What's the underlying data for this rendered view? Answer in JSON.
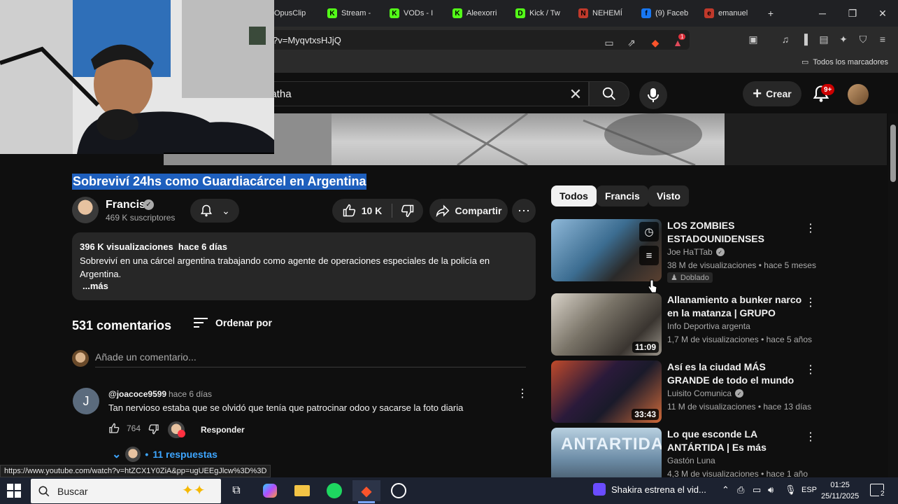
{
  "browser": {
    "tabs": [
      {
        "label": "OpusClip",
        "fav_color": "#4d5bd1",
        "fav_glyph": "O"
      },
      {
        "label": "Stream -",
        "fav_color": "#53fc18",
        "fav_glyph": "K"
      },
      {
        "label": "VODs - I",
        "fav_color": "#53fc18",
        "fav_glyph": "K"
      },
      {
        "label": "Aleexorri",
        "fav_color": "#53fc18",
        "fav_glyph": "K"
      },
      {
        "label": "Kick / Tw",
        "fav_color": "#53fc18",
        "fav_glyph": "D"
      },
      {
        "label": "NEHEMÍ",
        "fav_color": "#c0392b",
        "fav_glyph": "N"
      },
      {
        "label": "(9) Faceb",
        "fav_color": "#1877f2",
        "fav_glyph": "f"
      },
      {
        "label": "emanuel",
        "fav_color": "#c0392b",
        "fav_glyph": "e"
      }
    ],
    "new_tab": "+",
    "url": "?v=MyqvtxsHJjQ",
    "brave_shield_count": "1",
    "bookmarks_label": "Todos los marcadores"
  },
  "youtube": {
    "search_query": "natha",
    "create_label": "Crear",
    "notification_badge": "9+"
  },
  "video": {
    "title": "Sobreviví 24hs como Guardiacárcel en Argentina",
    "channel": "Francis",
    "subscribers": "469 K suscriptores",
    "likes": "10 K",
    "share_label": "Compartir",
    "views": "396 K visualizaciones",
    "age": "hace 6 días",
    "description": "Sobreviví en una cárcel argentina trabajando como agente de operaciones especiales de la policía en Argentina.",
    "more": "...más"
  },
  "comments": {
    "count": "531 comentarios",
    "sort_label": "Ordenar por",
    "add_placeholder": "Añade un comentario...",
    "items": [
      {
        "avatar_letter": "J",
        "handle": "@joacoce9599",
        "time": "hace 6 días",
        "text": "Tan nervioso estaba que se olvidó que tenía que patrocinar odoo y sacarse la foto diaria",
        "likes": "764",
        "reply_label": "Responder",
        "replies_label": "11 respuestas"
      }
    ]
  },
  "status_url": "https://www.youtube.com/watch?v=htZCX1Y0ZiA&pp=ugUEEgJlcw%3D%3D",
  "sidebar": {
    "chips": [
      "Todos",
      "Francis",
      "Visto"
    ],
    "videos": [
      {
        "title": "LOS ZOMBIES ESTADOUNIDENSES (JAMÁS ...",
        "channel": "Joe HaTTab",
        "verified": true,
        "meta": "38 M de visualizaciones • hace 5 meses",
        "badge": "Doblado",
        "duration": "",
        "thumb": "linear-gradient(135deg,#8fb8d8,#3c6d91 45%,#2a2a2a 70%,#5a4030)"
      },
      {
        "title": "Allanamiento a bunker narco en la matanza | GRUPO HALCON ...",
        "channel": "Info Deportiva argenta",
        "verified": false,
        "meta": "1,7 M de visualizaciones • hace 5 años",
        "badge": "",
        "duration": "11:09",
        "thumb": "linear-gradient(135deg,#d8d2c8,#7a7468 40%,#3a3530 75%,#9a948a)"
      },
      {
        "title": "Así es la ciudad MÁS GRANDE de todo el mundo (impactante...",
        "channel": "Luisito Comunica",
        "verified": true,
        "meta": "11 M de visualizaciones • hace 13 días",
        "badge": "",
        "duration": "33:43",
        "thumb": "linear-gradient(135deg,#c04a2a,#2a1a3a 40%,#1a1a2a 60%,#d06a3a)"
      },
      {
        "title": "Lo que esconde LA ANTÁRTIDA | Es más importante de lo que ...",
        "channel": "Gastón Luna",
        "verified": false,
        "meta": "4,3 M de visualizaciones • hace 1 año",
        "badge": "",
        "duration": "",
        "thumb": "linear-gradient(180deg,#b8d0e0,#6e8ea8 50%,#3a4a58)"
      }
    ],
    "thumb4_text": "ANTARTIDA"
  },
  "taskbar": {
    "search_placeholder": "Buscar",
    "news": "Shakira estrena el vid...",
    "language": "ESP",
    "time": "01:25",
    "date": "25/11/2025",
    "notifications": "2"
  }
}
